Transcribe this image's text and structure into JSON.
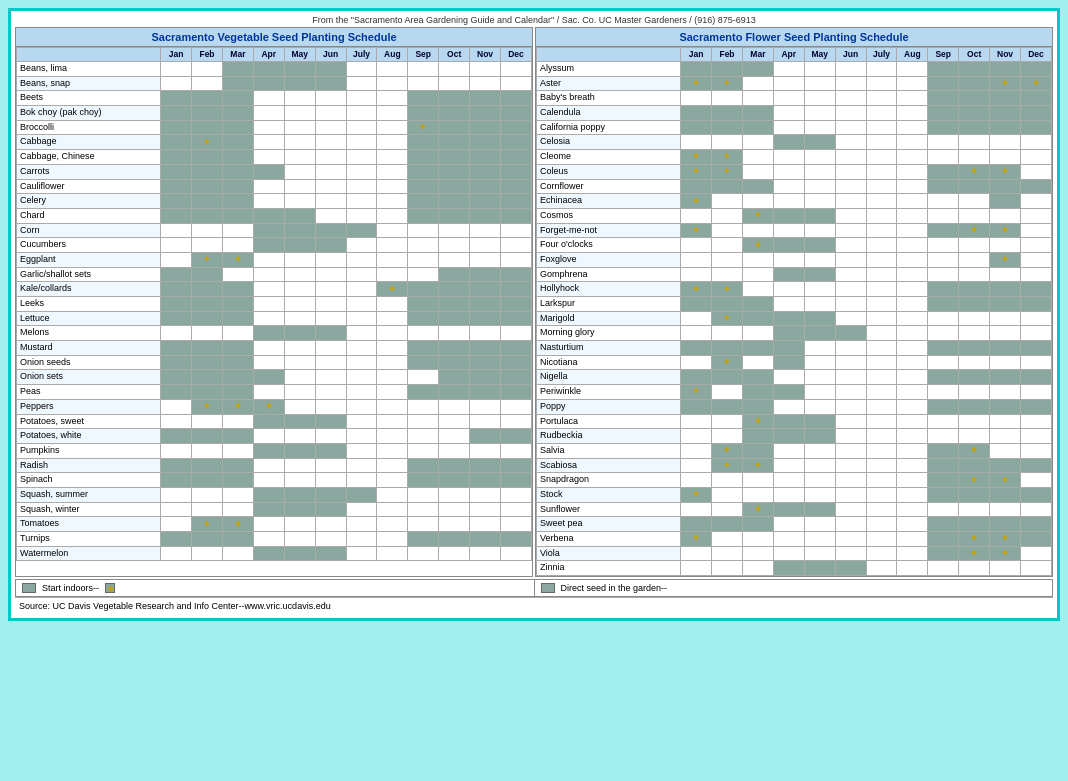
{
  "header": {
    "source": "From the \"Sacramento Area Gardening Guide and Calendar\" / Sac. Co. UC Master Gardeners / (916) 875-6913"
  },
  "vegTitle": "Sacramento Vegetable Seed Planting Schedule",
  "flowerTitle": "Sacramento Flower Seed Planting Schedule",
  "months": [
    "Jan",
    "Feb",
    "Mar",
    "Apr",
    "May",
    "Jun",
    "July",
    "Aug",
    "Sep",
    "Oct",
    "Nov",
    "Dec"
  ],
  "vegetables": [
    {
      "name": "Beans, lima",
      "months": [
        0,
        0,
        1,
        1,
        1,
        1,
        0,
        0,
        0,
        0,
        0,
        0
      ]
    },
    {
      "name": "Beans, snap",
      "months": [
        0,
        0,
        1,
        1,
        1,
        1,
        0,
        0,
        0,
        0,
        0,
        0
      ]
    },
    {
      "name": "Beets",
      "months": [
        1,
        1,
        1,
        0,
        0,
        0,
        0,
        0,
        1,
        1,
        1,
        1
      ]
    },
    {
      "name": "Bok choy (pak choy)",
      "months": [
        1,
        1,
        1,
        0,
        0,
        0,
        0,
        0,
        1,
        1,
        1,
        1
      ]
    },
    {
      "name": "Broccolli",
      "months": [
        1,
        1,
        1,
        0,
        0,
        0,
        0,
        0,
        "*",
        1,
        1,
        1
      ]
    },
    {
      "name": "Cabbage",
      "months": [
        1,
        "*",
        1,
        0,
        0,
        0,
        0,
        0,
        1,
        1,
        1,
        1
      ]
    },
    {
      "name": "Cabbage, Chinese",
      "months": [
        1,
        1,
        1,
        0,
        0,
        0,
        0,
        0,
        1,
        1,
        1,
        1
      ]
    },
    {
      "name": "Carrots",
      "months": [
        1,
        1,
        1,
        1,
        0,
        0,
        0,
        0,
        1,
        1,
        1,
        1
      ]
    },
    {
      "name": "Cauliflower",
      "months": [
        1,
        1,
        1,
        0,
        0,
        0,
        0,
        0,
        1,
        1,
        1,
        1
      ]
    },
    {
      "name": "Celery",
      "months": [
        1,
        1,
        1,
        0,
        0,
        0,
        0,
        0,
        1,
        1,
        1,
        1
      ]
    },
    {
      "name": "Chard",
      "months": [
        1,
        1,
        1,
        1,
        1,
        0,
        0,
        0,
        1,
        1,
        1,
        1
      ]
    },
    {
      "name": "Corn",
      "months": [
        0,
        0,
        0,
        1,
        1,
        1,
        1,
        0,
        0,
        0,
        0,
        0
      ]
    },
    {
      "name": "Cucumbers",
      "months": [
        0,
        0,
        0,
        1,
        1,
        1,
        0,
        0,
        0,
        0,
        0,
        0
      ]
    },
    {
      "name": "Eggplant",
      "months": [
        0,
        "*",
        "*",
        0,
        0,
        0,
        0,
        0,
        0,
        0,
        0,
        0
      ]
    },
    {
      "name": "Garlic/shallot sets",
      "months": [
        1,
        1,
        0,
        0,
        0,
        0,
        0,
        0,
        0,
        1,
        1,
        1
      ]
    },
    {
      "name": "Kale/collards",
      "months": [
        1,
        1,
        1,
        0,
        0,
        0,
        0,
        "*",
        1,
        1,
        1,
        1
      ]
    },
    {
      "name": "Leeks",
      "months": [
        1,
        1,
        1,
        0,
        0,
        0,
        0,
        0,
        1,
        1,
        1,
        1
      ]
    },
    {
      "name": "Lettuce",
      "months": [
        1,
        1,
        1,
        0,
        0,
        0,
        0,
        0,
        1,
        1,
        1,
        1
      ]
    },
    {
      "name": "Melons",
      "months": [
        0,
        0,
        0,
        1,
        1,
        1,
        0,
        0,
        0,
        0,
        0,
        0
      ]
    },
    {
      "name": "Mustard",
      "months": [
        1,
        1,
        1,
        0,
        0,
        0,
        0,
        0,
        1,
        1,
        1,
        1
      ]
    },
    {
      "name": "Onion seeds",
      "months": [
        1,
        1,
        1,
        0,
        0,
        0,
        0,
        0,
        1,
        1,
        1,
        1
      ]
    },
    {
      "name": "Onion sets",
      "months": [
        1,
        1,
        1,
        1,
        0,
        0,
        0,
        0,
        0,
        1,
        1,
        1
      ]
    },
    {
      "name": "Peas",
      "months": [
        1,
        1,
        1,
        0,
        0,
        0,
        0,
        0,
        1,
        1,
        1,
        1
      ]
    },
    {
      "name": "Peppers",
      "months": [
        0,
        "*",
        "*",
        "*",
        0,
        0,
        0,
        0,
        0,
        0,
        0,
        0
      ]
    },
    {
      "name": "Potatoes, sweet",
      "months": [
        0,
        0,
        0,
        1,
        1,
        1,
        0,
        0,
        0,
        0,
        0,
        0
      ]
    },
    {
      "name": "Potatoes, white",
      "months": [
        1,
        1,
        1,
        0,
        0,
        0,
        0,
        0,
        0,
        0,
        1,
        1
      ]
    },
    {
      "name": "Pumpkins",
      "months": [
        0,
        0,
        0,
        1,
        1,
        1,
        0,
        0,
        0,
        0,
        0,
        0
      ]
    },
    {
      "name": "Radish",
      "months": [
        1,
        1,
        1,
        0,
        0,
        0,
        0,
        0,
        1,
        1,
        1,
        1
      ]
    },
    {
      "name": "Spinach",
      "months": [
        1,
        1,
        1,
        0,
        0,
        0,
        0,
        0,
        1,
        1,
        1,
        1
      ]
    },
    {
      "name": "Squash, summer",
      "months": [
        0,
        0,
        0,
        1,
        1,
        1,
        1,
        0,
        0,
        0,
        0,
        0
      ]
    },
    {
      "name": "Squash, winter",
      "months": [
        0,
        0,
        0,
        1,
        1,
        1,
        0,
        0,
        0,
        0,
        0,
        0
      ]
    },
    {
      "name": "Tomatoes",
      "months": [
        0,
        "*",
        "*",
        0,
        0,
        0,
        0,
        0,
        0,
        0,
        0,
        0
      ]
    },
    {
      "name": "Turnips",
      "months": [
        1,
        1,
        1,
        0,
        0,
        0,
        0,
        0,
        1,
        1,
        1,
        1
      ]
    },
    {
      "name": "Watermelon",
      "months": [
        0,
        0,
        0,
        1,
        1,
        1,
        0,
        0,
        0,
        0,
        0,
        0
      ]
    }
  ],
  "flowers": [
    {
      "name": "Alyssum",
      "months": [
        1,
        1,
        1,
        0,
        0,
        0,
        0,
        0,
        1,
        1,
        1,
        1
      ]
    },
    {
      "name": "Aster",
      "months": [
        "*",
        "*",
        0,
        0,
        0,
        0,
        0,
        0,
        1,
        1,
        "*",
        "*"
      ]
    },
    {
      "name": "Baby's breath",
      "months": [
        0,
        0,
        0,
        0,
        0,
        0,
        0,
        0,
        1,
        1,
        1,
        1
      ]
    },
    {
      "name": "Calendula",
      "months": [
        1,
        1,
        1,
        0,
        0,
        0,
        0,
        0,
        1,
        1,
        1,
        1
      ]
    },
    {
      "name": "California poppy",
      "months": [
        1,
        1,
        1,
        0,
        0,
        0,
        0,
        0,
        1,
        1,
        1,
        1
      ]
    },
    {
      "name": "Celosia",
      "months": [
        0,
        0,
        0,
        1,
        1,
        0,
        0,
        0,
        0,
        0,
        0,
        0
      ]
    },
    {
      "name": "Cleome",
      "months": [
        "*",
        "*",
        0,
        0,
        0,
        0,
        0,
        0,
        0,
        0,
        0,
        0
      ]
    },
    {
      "name": "Coleus",
      "months": [
        "*",
        "*",
        0,
        0,
        0,
        0,
        0,
        0,
        1,
        "*",
        "*",
        0
      ]
    },
    {
      "name": "Cornflower",
      "months": [
        1,
        1,
        1,
        0,
        0,
        0,
        0,
        0,
        1,
        1,
        1,
        1
      ]
    },
    {
      "name": "Echinacea",
      "months": [
        "*",
        0,
        0,
        0,
        0,
        0,
        0,
        0,
        0,
        0,
        1,
        0
      ]
    },
    {
      "name": "Cosmos",
      "months": [
        0,
        0,
        "*",
        1,
        1,
        0,
        0,
        0,
        0,
        0,
        0,
        0
      ]
    },
    {
      "name": "Forget-me-not",
      "months": [
        "*",
        0,
        0,
        0,
        0,
        0,
        0,
        0,
        1,
        "*",
        "*",
        0
      ]
    },
    {
      "name": "Four o'clocks",
      "months": [
        0,
        0,
        "*",
        1,
        1,
        0,
        0,
        0,
        0,
        0,
        0,
        0
      ]
    },
    {
      "name": "Foxglove",
      "months": [
        0,
        0,
        0,
        0,
        0,
        0,
        0,
        0,
        0,
        0,
        "*",
        0
      ]
    },
    {
      "name": "Gomphrena",
      "months": [
        0,
        0,
        0,
        1,
        1,
        0,
        0,
        0,
        0,
        0,
        0,
        0
      ]
    },
    {
      "name": "Hollyhock",
      "months": [
        "*",
        "*",
        0,
        0,
        0,
        0,
        0,
        0,
        1,
        1,
        1,
        1
      ]
    },
    {
      "name": "Larkspur",
      "months": [
        1,
        1,
        1,
        0,
        0,
        0,
        0,
        0,
        1,
        1,
        1,
        1
      ]
    },
    {
      "name": "Marigold",
      "months": [
        0,
        "*",
        1,
        1,
        1,
        0,
        0,
        0,
        0,
        0,
        0,
        0
      ]
    },
    {
      "name": "Morning glory",
      "months": [
        0,
        0,
        0,
        1,
        1,
        1,
        0,
        0,
        0,
        0,
        0,
        0
      ]
    },
    {
      "name": "Nasturtium",
      "months": [
        1,
        1,
        1,
        1,
        0,
        0,
        0,
        0,
        1,
        1,
        1,
        1
      ]
    },
    {
      "name": "Nicotiana",
      "months": [
        0,
        "*",
        0,
        1,
        0,
        0,
        0,
        0,
        0,
        0,
        0,
        0
      ]
    },
    {
      "name": "Nigella",
      "months": [
        1,
        1,
        1,
        0,
        0,
        0,
        0,
        0,
        1,
        1,
        1,
        1
      ]
    },
    {
      "name": "Periwinkle",
      "months": [
        "*",
        0,
        1,
        1,
        0,
        0,
        0,
        0,
        0,
        0,
        0,
        0
      ]
    },
    {
      "name": "Poppy",
      "months": [
        1,
        1,
        1,
        0,
        0,
        0,
        0,
        0,
        1,
        1,
        1,
        1
      ]
    },
    {
      "name": "Portulaca",
      "months": [
        0,
        0,
        "*",
        1,
        1,
        0,
        0,
        0,
        0,
        0,
        0,
        0
      ]
    },
    {
      "name": "Rudbeckia",
      "months": [
        0,
        0,
        1,
        1,
        1,
        0,
        0,
        0,
        0,
        0,
        0,
        0
      ]
    },
    {
      "name": "Salvia",
      "months": [
        0,
        "*",
        1,
        0,
        0,
        0,
        0,
        0,
        1,
        "*",
        0,
        0
      ]
    },
    {
      "name": "Scabiosa",
      "months": [
        0,
        "*",
        "*",
        0,
        0,
        0,
        0,
        0,
        1,
        1,
        1,
        1
      ]
    },
    {
      "name": "Snapdragon",
      "months": [
        0,
        0,
        0,
        0,
        0,
        0,
        0,
        0,
        1,
        "*",
        "*",
        0
      ]
    },
    {
      "name": "Stock",
      "months": [
        "*",
        0,
        0,
        0,
        0,
        0,
        0,
        0,
        1,
        1,
        1,
        1
      ]
    },
    {
      "name": "Sunflower",
      "months": [
        0,
        0,
        "*",
        1,
        1,
        0,
        0,
        0,
        0,
        0,
        0,
        0
      ]
    },
    {
      "name": "Sweet pea",
      "months": [
        1,
        1,
        1,
        0,
        0,
        0,
        0,
        0,
        1,
        1,
        1,
        1
      ]
    },
    {
      "name": "Verbena",
      "months": [
        "*",
        0,
        0,
        0,
        0,
        0,
        0,
        0,
        1,
        "*",
        "*",
        1
      ]
    },
    {
      "name": "Viola",
      "months": [
        0,
        0,
        0,
        0,
        0,
        0,
        0,
        0,
        1,
        "*",
        "*",
        0
      ]
    },
    {
      "name": "Zinnia",
      "months": [
        0,
        0,
        0,
        1,
        1,
        1,
        0,
        0,
        0,
        0,
        0,
        0
      ]
    }
  ],
  "bottomLeft": "Start indoors--",
  "bottomRight": "Direct seed in the garden--",
  "sourceText": "Source:  UC Davis Vegetable Research and Info Center--www.vric.ucdavis.edu"
}
